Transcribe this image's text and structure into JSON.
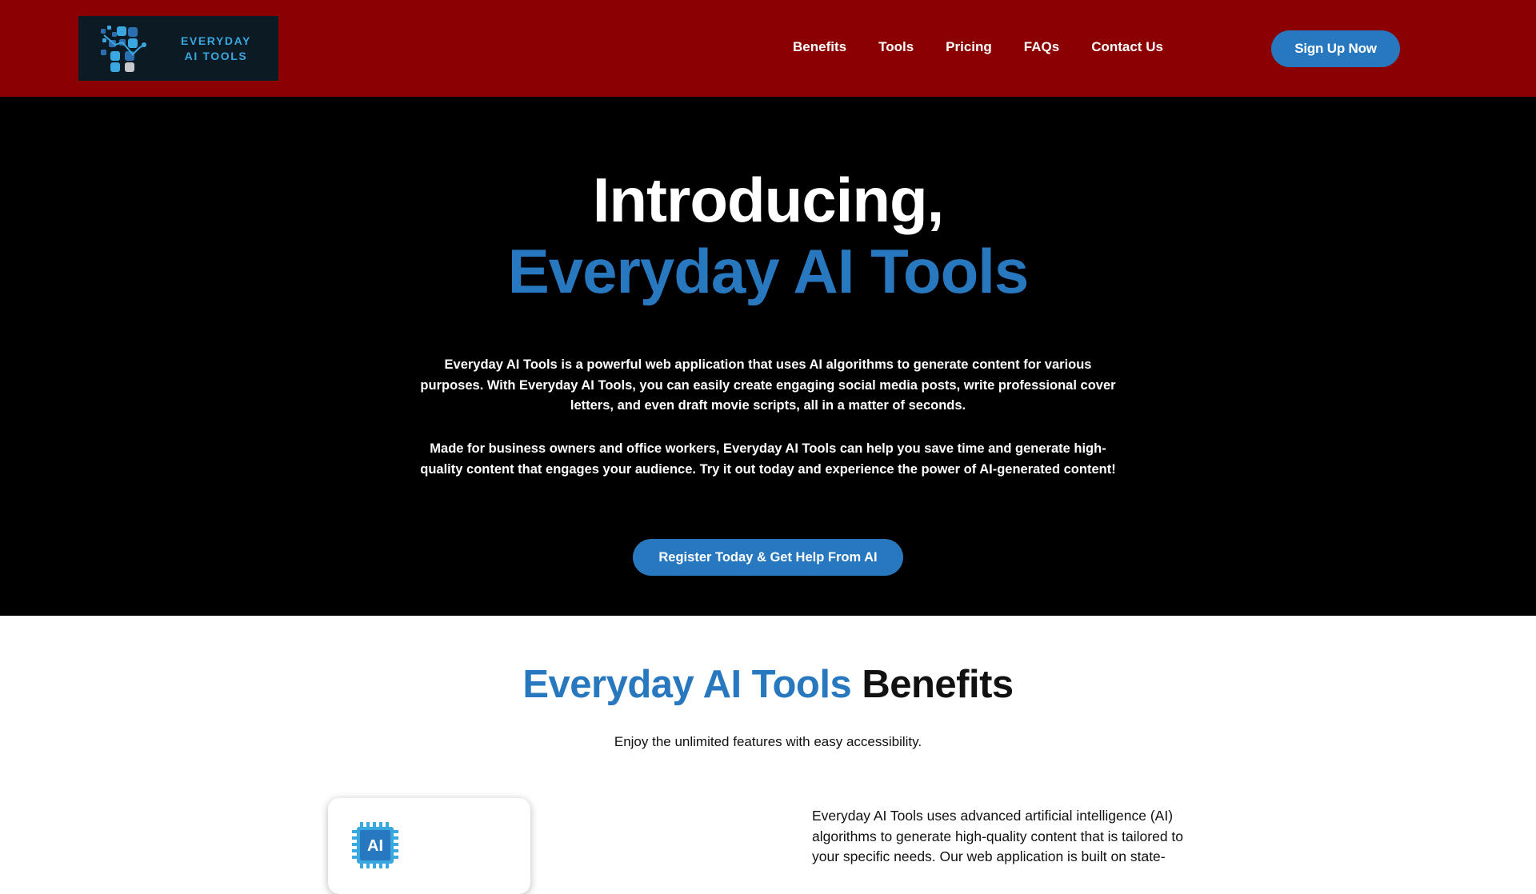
{
  "brand": {
    "line1": "EVERYDAY",
    "line2": "AI TOOLS",
    "accent_color": "#3aa7e0",
    "logo_bg": "#0c1a24"
  },
  "header": {
    "bg_color": "#8b0000",
    "nav": [
      "Benefits",
      "Tools",
      "Pricing",
      "FAQs",
      "Contact Us"
    ],
    "signup_label": "Sign Up Now"
  },
  "hero": {
    "bg_color": "#000000",
    "title_line1": "Introducing,",
    "title_line2": "Everyday AI Tools",
    "paragraph1": "Everyday AI Tools is a powerful web application that uses AI algorithms to generate content for various purposes. With Everyday AI Tools, you can easily create engaging social media posts, write professional cover letters, and even draft movie scripts, all in a matter of seconds.",
    "paragraph2": "Made for business owners and office workers, Everyday AI Tools can help you save time and generate high-quality content that engages your audience. Try it out today and experience the power of AI-generated content!",
    "cta_label": "Register Today & Get Help From AI"
  },
  "benefits": {
    "title_blue": "Everyday AI Tools",
    "title_dark": "Benefits",
    "subtitle": "Enjoy the unlimited features with easy accessibility.",
    "card_icon": "ai-chip-icon",
    "card_icon_label": "AI",
    "description": "Everyday AI Tools uses advanced artificial intelligence (AI) algorithms to generate high-quality content that is tailored to your specific needs. Our web application is built on state-"
  },
  "colors": {
    "primary": "#2878c0",
    "white": "#ffffff"
  }
}
